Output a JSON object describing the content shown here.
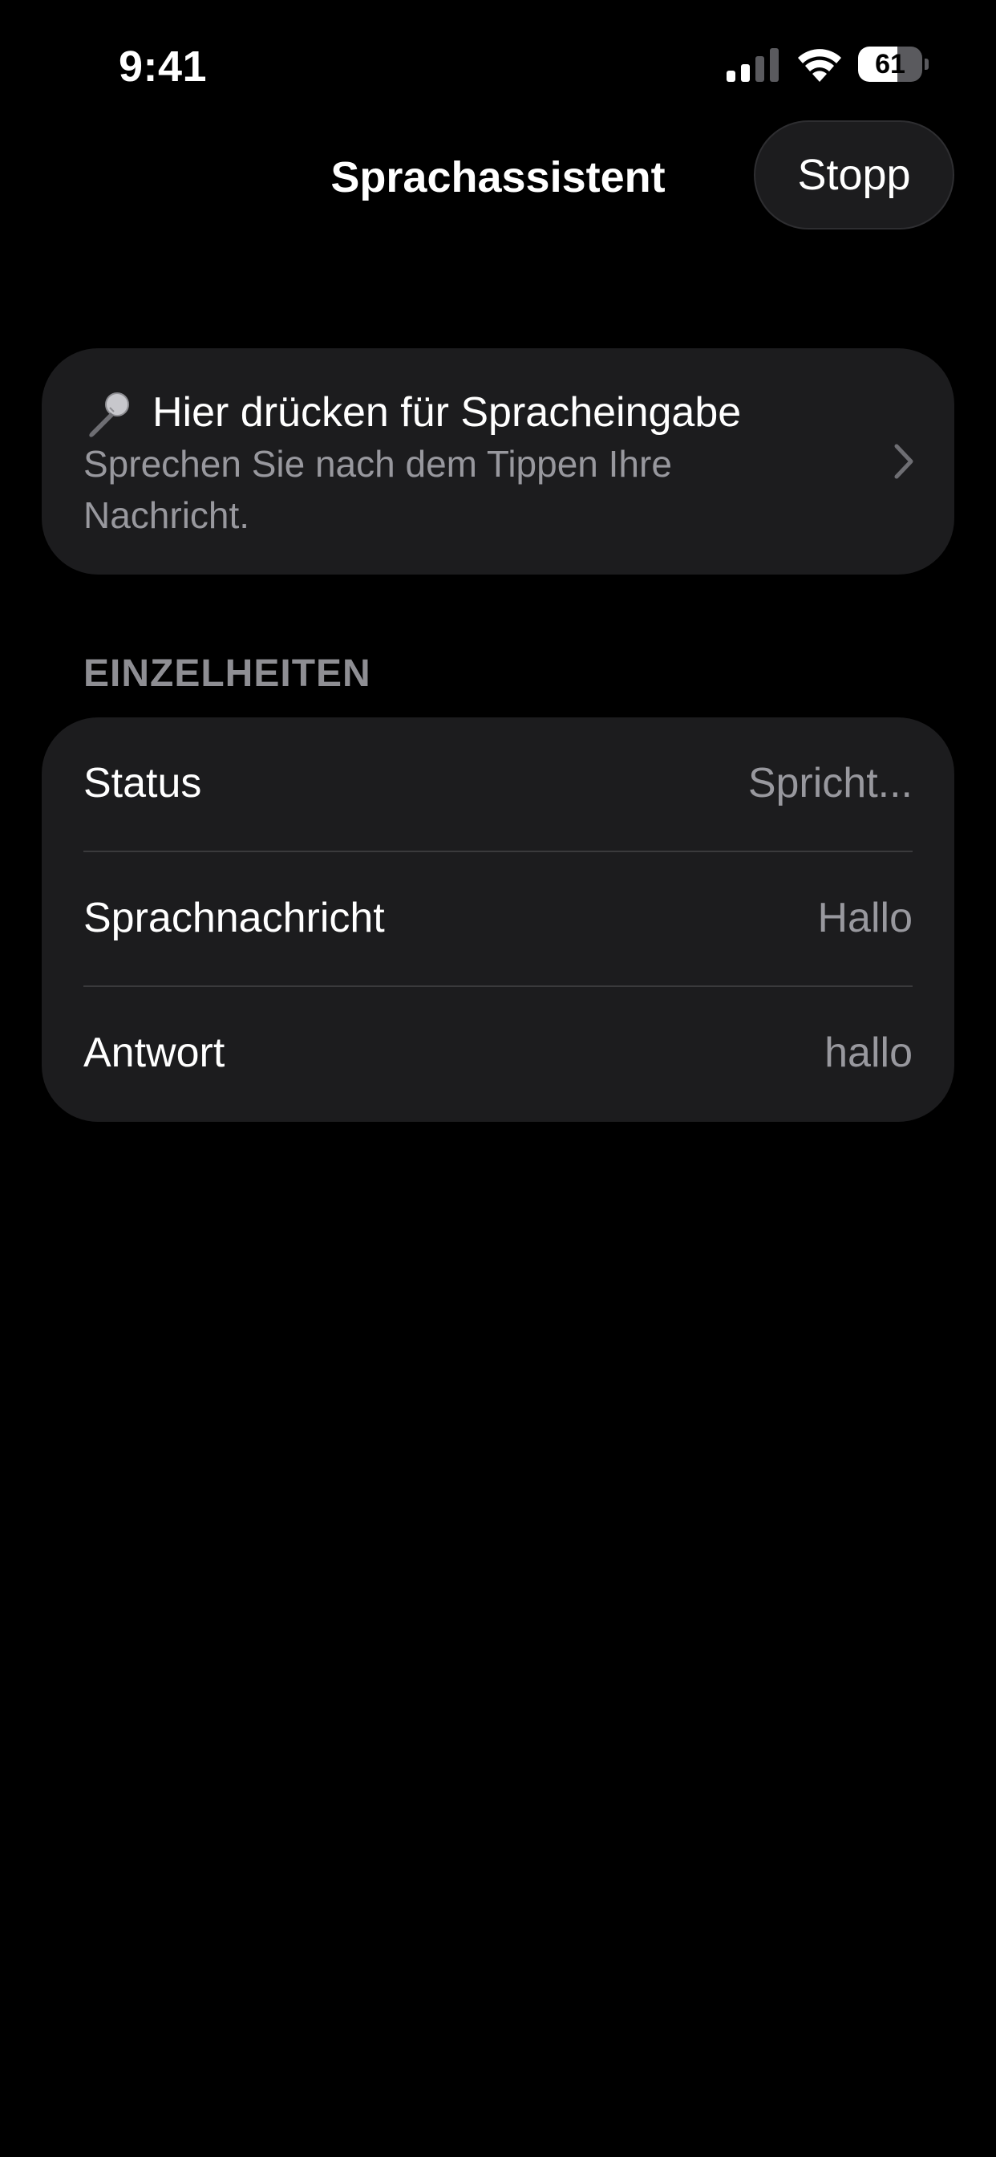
{
  "status_bar": {
    "time": "9:41",
    "battery_level": "61",
    "battery_fraction": 0.61,
    "icons": [
      "signal-icon",
      "wifi-icon",
      "battery-icon"
    ]
  },
  "nav": {
    "title": "Sprachassistent",
    "stop_label": "Stopp"
  },
  "voice_card": {
    "icon": "microphone-icon",
    "title": "Hier drücken für Spracheingabe",
    "subtitle": "Sprechen Sie nach dem Tippen Ihre Nachricht."
  },
  "details": {
    "header": "EINZELHEITEN",
    "rows": [
      {
        "label": "Status",
        "value": "Spricht..."
      },
      {
        "label": "Sprachnachricht",
        "value": "Hallo"
      },
      {
        "label": "Antwort",
        "value": "hallo"
      }
    ]
  },
  "colors": {
    "background": "#000000",
    "card": "#1c1c1e",
    "secondary_text": "#98989e",
    "section_header": "#8e8e93",
    "divider": "#3a3a3c"
  }
}
